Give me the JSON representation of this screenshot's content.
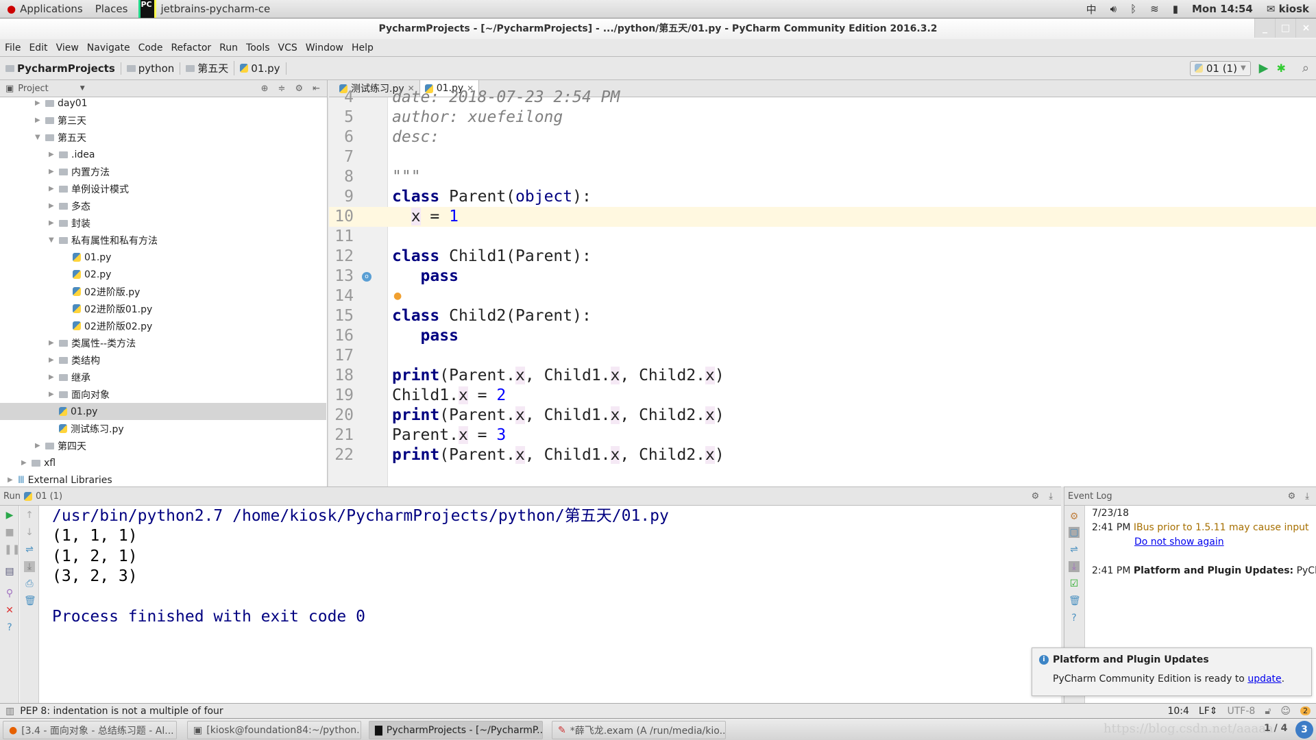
{
  "topbar": {
    "applications": "Applications",
    "places": "Places",
    "app": "jetbrains-pycharm-ce",
    "ime": "中",
    "clock": "Mon 14:54",
    "user": "kiosk"
  },
  "window": {
    "title": "PycharmProjects - [~/PycharmProjects] - .../python/第五天/01.py - PyCharm Community Edition 2016.3.2"
  },
  "menu": [
    "File",
    "Edit",
    "View",
    "Navigate",
    "Code",
    "Refactor",
    "Run",
    "Tools",
    "VCS",
    "Window",
    "Help"
  ],
  "breadcrumb": [
    "PycharmProjects",
    "python",
    "第五天",
    "01.py"
  ],
  "run_config": "01 (1)",
  "project": {
    "title": "Project",
    "tree": [
      {
        "label": "day01",
        "level": 1,
        "type": "folder",
        "state": "collapsed"
      },
      {
        "label": "第三天",
        "level": 1,
        "type": "folder",
        "state": "collapsed"
      },
      {
        "label": "第五天",
        "level": 1,
        "type": "folder",
        "state": "expanded"
      },
      {
        "label": ".idea",
        "level": 2,
        "type": "folder",
        "state": "collapsed"
      },
      {
        "label": "内置方法",
        "level": 2,
        "type": "folder",
        "state": "collapsed"
      },
      {
        "label": "单例设计模式",
        "level": 2,
        "type": "folder",
        "state": "collapsed"
      },
      {
        "label": "多态",
        "level": 2,
        "type": "folder",
        "state": "collapsed"
      },
      {
        "label": "封装",
        "level": 2,
        "type": "folder",
        "state": "collapsed"
      },
      {
        "label": "私有属性和私有方法",
        "level": 2,
        "type": "folder",
        "state": "expanded"
      },
      {
        "label": "01.py",
        "level": 3,
        "type": "file"
      },
      {
        "label": "02.py",
        "level": 3,
        "type": "file"
      },
      {
        "label": "02进阶版.py",
        "level": 3,
        "type": "file"
      },
      {
        "label": "02进阶版01.py",
        "level": 3,
        "type": "file"
      },
      {
        "label": "02进阶版02.py",
        "level": 3,
        "type": "file"
      },
      {
        "label": "类属性--类方法",
        "level": 2,
        "type": "folder",
        "state": "collapsed"
      },
      {
        "label": "类结构",
        "level": 2,
        "type": "folder",
        "state": "collapsed"
      },
      {
        "label": "继承",
        "level": 2,
        "type": "folder",
        "state": "collapsed"
      },
      {
        "label": "面向对象",
        "level": 2,
        "type": "folder",
        "state": "collapsed"
      },
      {
        "label": "01.py",
        "level": 2,
        "type": "file",
        "selected": true
      },
      {
        "label": "测试练习.py",
        "level": 2,
        "type": "file"
      },
      {
        "label": "第四天",
        "level": 1,
        "type": "folder",
        "state": "collapsed"
      },
      {
        "label": "xfl",
        "level": 0,
        "type": "folder",
        "state": "collapsed"
      },
      {
        "label": "External Libraries",
        "level": -1,
        "type": "library",
        "state": "collapsed"
      }
    ]
  },
  "editor": {
    "tabs": [
      {
        "label": "测试练习.py",
        "active": false
      },
      {
        "label": "01.py",
        "active": true
      }
    ],
    "current_line": 10,
    "lines": [
      {
        "n": "4",
        "t": [
          [
            "date: 2018-07-23 2:54 PM",
            "cm"
          ]
        ]
      },
      {
        "n": "5",
        "t": [
          [
            "author: xuefeilong",
            "cm"
          ]
        ]
      },
      {
        "n": "6",
        "t": [
          [
            "desc:",
            "cm"
          ]
        ]
      },
      {
        "n": "7",
        "t": []
      },
      {
        "n": "8",
        "t": [
          [
            "\"\"\"",
            "cm"
          ]
        ]
      },
      {
        "n": "9",
        "t": [
          [
            "class",
            "kw"
          ],
          [
            " Parent(",
            ""
          ],
          [
            "object",
            "bi"
          ],
          [
            "):",
            ""
          ]
        ]
      },
      {
        "n": "10",
        "t": [
          [
            "  ",
            ""
          ],
          [
            "x",
            "fld"
          ],
          [
            " = ",
            ""
          ],
          [
            "1",
            "num"
          ]
        ]
      },
      {
        "n": "11",
        "t": []
      },
      {
        "n": "12",
        "t": [
          [
            "class",
            "kw"
          ],
          [
            " Child1(Parent):",
            ""
          ]
        ]
      },
      {
        "n": "13",
        "t": [
          [
            "   ",
            ""
          ],
          [
            "pass",
            "kw"
          ]
        ]
      },
      {
        "n": "14",
        "t": []
      },
      {
        "n": "15",
        "t": [
          [
            "class",
            "kw"
          ],
          [
            " Child2(Parent):",
            ""
          ]
        ]
      },
      {
        "n": "16",
        "t": [
          [
            "   ",
            ""
          ],
          [
            "pass",
            "kw"
          ]
        ]
      },
      {
        "n": "17",
        "t": []
      },
      {
        "n": "18",
        "t": [
          [
            "print",
            "kw"
          ],
          [
            "(Parent.",
            ""
          ],
          [
            "x",
            "fld"
          ],
          [
            ", Child1.",
            ""
          ],
          [
            "x",
            "fld"
          ],
          [
            ", Child2.",
            ""
          ],
          [
            "x",
            "fld"
          ],
          [
            ")",
            ""
          ]
        ]
      },
      {
        "n": "19",
        "t": [
          [
            "Child1.",
            ""
          ],
          [
            "x",
            "fld"
          ],
          [
            " = ",
            ""
          ],
          [
            "2",
            "num"
          ]
        ]
      },
      {
        "n": "20",
        "t": [
          [
            "print",
            "kw"
          ],
          [
            "(Parent.",
            ""
          ],
          [
            "x",
            "fld"
          ],
          [
            ", Child1.",
            ""
          ],
          [
            "x",
            "fld"
          ],
          [
            ", Child2.",
            ""
          ],
          [
            "x",
            "fld"
          ],
          [
            ")",
            ""
          ]
        ]
      },
      {
        "n": "21",
        "t": [
          [
            "Parent.",
            ""
          ],
          [
            "x",
            "fld"
          ],
          [
            " = ",
            ""
          ],
          [
            "3",
            "num"
          ]
        ]
      },
      {
        "n": "22",
        "t": [
          [
            "print",
            "kw"
          ],
          [
            "(Parent.",
            ""
          ],
          [
            "x",
            "fld"
          ],
          [
            ", Child1.",
            ""
          ],
          [
            "x",
            "fld"
          ],
          [
            ", Child2.",
            ""
          ],
          [
            "x",
            "fld"
          ],
          [
            ")",
            ""
          ]
        ]
      }
    ]
  },
  "run": {
    "label": "Run",
    "config": "01 (1)",
    "output": [
      {
        "text": "/usr/bin/python2.7 /home/kiosk/PycharmProjects/python/第五天/01.py",
        "color": "#000080"
      },
      {
        "text": "(1, 1, 1)",
        "color": "#000000"
      },
      {
        "text": "(1, 2, 1)",
        "color": "#000000"
      },
      {
        "text": "(3, 2, 3)",
        "color": "#000000"
      },
      {
        "text": "",
        "color": "#000000"
      },
      {
        "text": "Process finished with exit code 0",
        "color": "#000080"
      }
    ]
  },
  "event_log": {
    "title": "Event Log",
    "date": "7/23/18",
    "e1_time": "2:41 PM",
    "e1_text": "IBus prior to 1.5.11 may cause input",
    "e1_link": "Do not show again",
    "e2_time": "2:41 PM",
    "e2_title": "Platform and Plugin Updates:",
    "e2_text": " PyCh"
  },
  "popup": {
    "title": "Platform and Plugin Updates",
    "text": "PyCharm Community Edition is ready to ",
    "link": "update"
  },
  "status": {
    "message": "PEP 8: indentation is not a multiple of four",
    "position": "10:4",
    "line_sep": "LF",
    "encoding": "UTF-8",
    "notifications": "2"
  },
  "taskbar": {
    "items": [
      {
        "label": "[3.4 - 面向对象 - 总结练习题 - Al...",
        "icon": "firefox-icon"
      },
      {
        "label": "[kiosk@foundation84:~/python...",
        "icon": "terminal-icon"
      },
      {
        "label": "PycharmProjects - [~/PycharmP...",
        "icon": "pycharm-icon",
        "active": true
      },
      {
        "label": "*薛飞龙.exam (A /run/media/kio...",
        "icon": "text-editor-icon"
      }
    ],
    "workspace": "1 / 4",
    "badge": "3",
    "watermark": "https://blog.csdn.net/aaaaa"
  },
  "colors": {
    "keyword": "#000080",
    "number": "#0000ff",
    "comment": "#808080",
    "warning": "#a66f00",
    "link": "#0000ee",
    "current_line": "#fff8e0"
  }
}
